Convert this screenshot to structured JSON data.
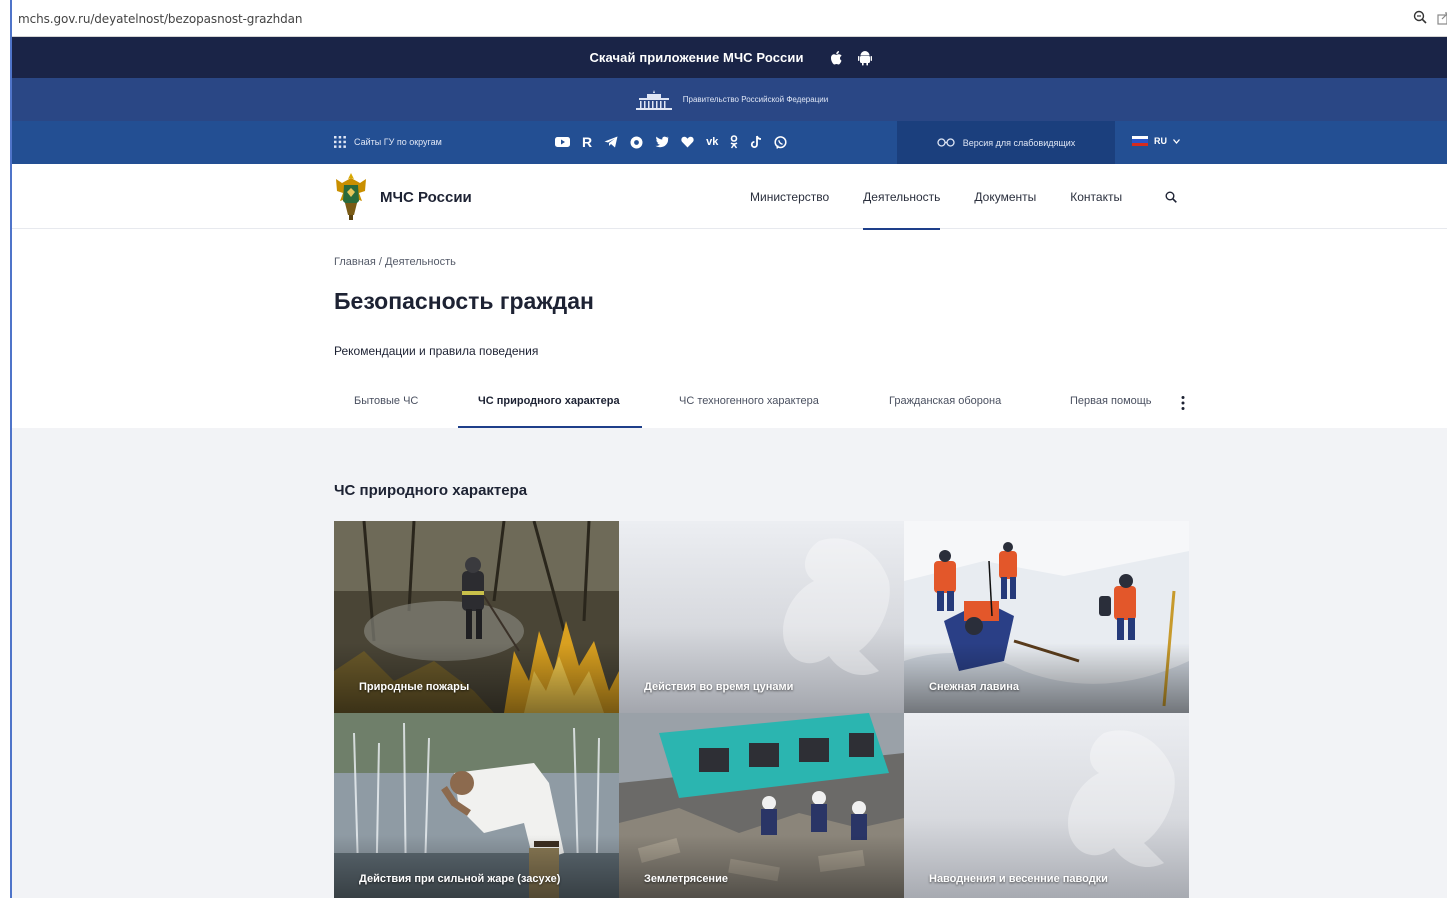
{
  "browser": {
    "url": "mchs.gov.ru/deyatelnost/bezopasnost-grazhdan"
  },
  "app_banner": {
    "text": "Скачай приложение МЧС России"
  },
  "gov_banner": {
    "text": "Правительство Российской Федерации"
  },
  "topbar": {
    "sites_label": "Сайты ГУ по округам",
    "social_icons": [
      "youtube-icon",
      "rutube-icon",
      "telegram-icon",
      "ok-icon",
      "twitter-icon",
      "heart-icon",
      "vk-icon",
      "odnoklassniki-icon",
      "tiktok-icon",
      "viber-icon"
    ],
    "vision_label": "Версия для слабовидящих",
    "lang_label": "RU"
  },
  "header": {
    "brand": "МЧС России",
    "nav": [
      "Министерство",
      "Деятельность",
      "Документы",
      "Контакты"
    ]
  },
  "page": {
    "breadcrumb": "Главная / Деятельность",
    "title": "Безопасность граждан",
    "subtitle": "Рекомендации и правила поведения",
    "tabs": [
      "Бытовые ЧС",
      "ЧС природного характера",
      "ЧС техногенного характера",
      "Гражданская оборона",
      "Первая помощь"
    ],
    "active_tab": "ЧС природного характера"
  },
  "section": {
    "title": "ЧС природного характера",
    "cards": [
      "Природные пожары",
      "Действия во время цунами",
      "Снежная лавина",
      "Действия при сильной жаре (засухе)",
      "Землетрясение",
      "Наводнения и весенние паводки"
    ]
  },
  "colors": {
    "app_banner": "#1a2447",
    "gov_banner": "#2a4785",
    "topbar": "#234f93",
    "accent": "#1e3f8a"
  }
}
